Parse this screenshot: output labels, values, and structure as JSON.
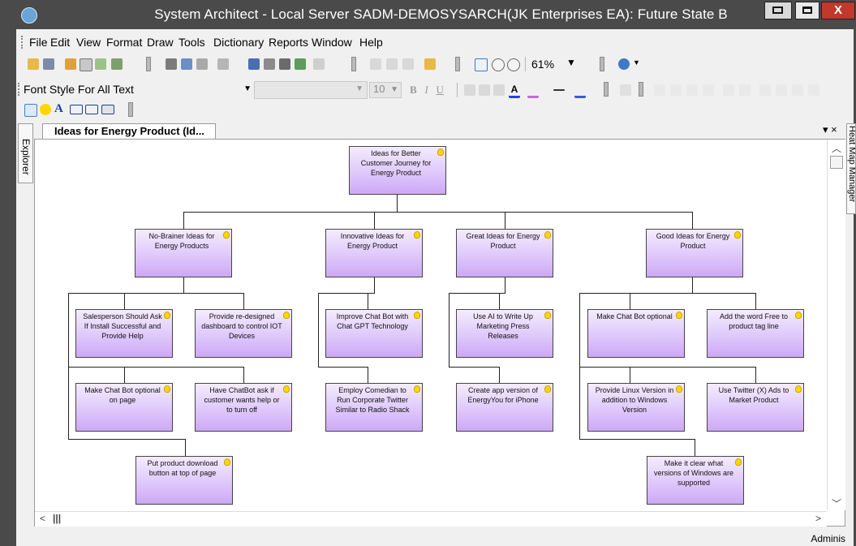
{
  "window": {
    "title": "System Architect - Local Server SADM-DEMOSYSARCH(JK Enterprises EA): Future State B",
    "close_label": "X"
  },
  "menu": [
    "File",
    "Edit",
    "View",
    "Format",
    "Draw",
    "Tools",
    "Dictionary",
    "Reports",
    "Window",
    "Help"
  ],
  "toolbar": {
    "zoom": "61%",
    "font_style": "Font Style For All Text",
    "font_size": "10"
  },
  "side_tabs": {
    "explorer": "Explorer",
    "heat_map_manager": "Heat Map Manager"
  },
  "document_tab": {
    "label": "Ideas for Energy Product (Id...",
    "controls": "▾ ×"
  },
  "diagram": {
    "root": "Ideas for Better Customer Journey for Energy Product",
    "categories": [
      "No-Brainer Ideas for Energy Products",
      "Innovative Ideas for Energy Product",
      "Great Ideas for Energy Product",
      "Good Ideas for Energy Product"
    ],
    "ideas": [
      "Salesperson Should Ask If Install Successful and Provide Help",
      "Provide re-designed dashboard to control IOT Devices",
      "Make Chat Bot optional on page",
      "Have ChatBot ask if customer wants help or to turn off",
      "Put product download button at top of page",
      "Improve Chat Bot with Chat GPT Technology",
      "Employ Comedian to Run Corporate Twitter Similar to Radio Shack",
      "Use AI to Write Up Marketing Press Releases",
      "Create app version of EnergyYou for iPhone",
      "Make Chat Bot optional",
      "Add the word Free to product tag line",
      "Provide Linux Version in addition to Windows Version",
      "Use Twitter (X) Ads to Market Product",
      "Make it clear what versions of Windows are supported"
    ]
  },
  "status": {
    "user": "Adminis"
  }
}
